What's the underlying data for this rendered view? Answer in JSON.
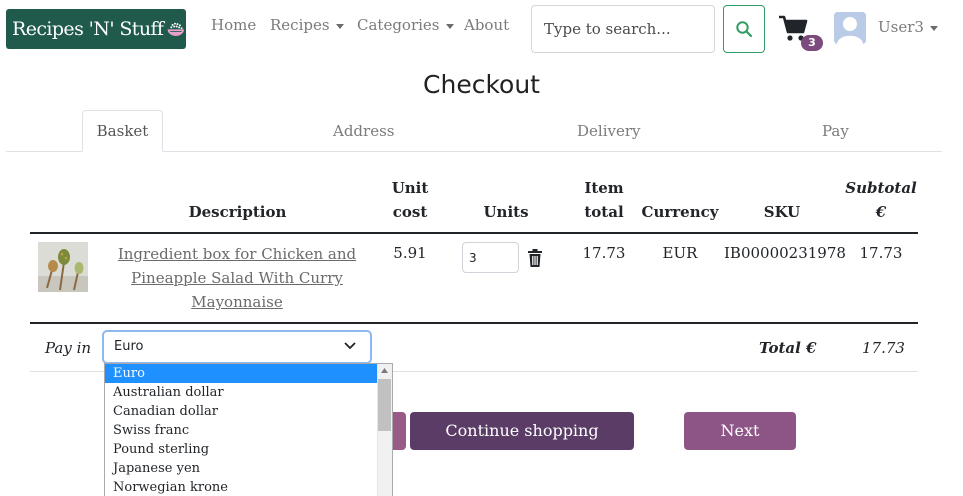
{
  "brand": {
    "name": "Recipes 'N' Stuff",
    "icon": "rice-bowl-icon",
    "color": "#1f5a4c"
  },
  "nav": {
    "home": "Home",
    "recipes": "Recipes",
    "categories": "Categories",
    "about": "About"
  },
  "search": {
    "placeholder": "Type to search...",
    "button_icon": "search-icon",
    "button_color": "#2f9c64"
  },
  "cart": {
    "icon": "shopping-cart-icon",
    "count": "3",
    "badge_color": "#7c4a7c"
  },
  "user": {
    "name": "User3",
    "avatar_icon": "user-avatar-icon"
  },
  "page": {
    "title": "Checkout"
  },
  "steps": [
    "Basket",
    "Address",
    "Delivery",
    "Pay"
  ],
  "table": {
    "headers": {
      "description": "Description",
      "unit_cost_1": "Unit",
      "unit_cost_2": "cost",
      "units": "Units",
      "item_total_1": "Item",
      "item_total_2": "total",
      "currency": "Currency",
      "sku": "SKU",
      "subtotal_1": "Subtotal",
      "subtotal_2": "€"
    },
    "rows": [
      {
        "description": "Ingredient box for Chicken and Pineapple Salad With Curry Mayonnaise",
        "unit_cost": "5.91",
        "units": "3",
        "item_total": "17.73",
        "currency": "EUR",
        "sku": "IB00000231978",
        "subtotal": "17.73"
      }
    ]
  },
  "pay": {
    "label": "Pay in",
    "selected": "Euro",
    "total_label": "Total €",
    "total_value": "17.73",
    "options": [
      "Euro",
      "Australian dollar",
      "Canadian dollar",
      "Swiss franc",
      "Pound sterling",
      "Japanese yen",
      "Norwegian krone"
    ]
  },
  "buttons": {
    "continue": "Continue shopping",
    "next": "Next",
    "continue_color": "#5a3c66",
    "next_color": "#8c5585"
  },
  "colors": {
    "dropdown_highlight": "#1e90ff"
  }
}
